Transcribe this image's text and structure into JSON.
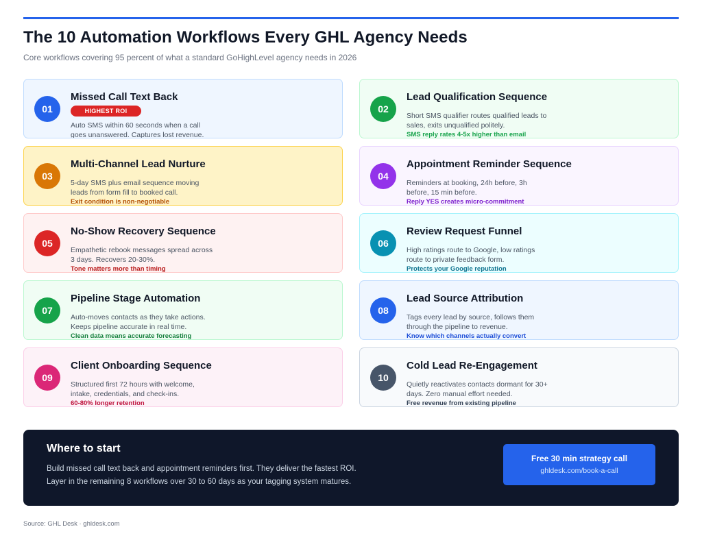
{
  "header": {
    "title": "The 10 Automation Workflows Every GHL Agency Needs",
    "subtitle": "Core workflows covering 95 percent of what a standard GoHighLevel agency needs in 2026"
  },
  "workflows": [
    {
      "number": "01",
      "title": "Missed Call Text Back",
      "badge": "HIGHEST ROI",
      "description": "Auto SMS within 60 seconds when a call goes unanswered. Captures lost revenue.",
      "note": ""
    },
    {
      "number": "02",
      "title": "Lead Qualification Sequence",
      "description": "Short SMS qualifier routes qualified leads to sales, exits unqualified politely.",
      "note": "SMS reply rates 4-5x higher than email"
    },
    {
      "number": "03",
      "title": "Multi-Channel Lead Nurture",
      "description": "5-day SMS plus email sequence moving leads from form fill to booked call.",
      "note": "Exit condition is non-negotiable"
    },
    {
      "number": "04",
      "title": "Appointment Reminder Sequence",
      "description": "Reminders at booking, 24h before, 3h before, 15 min before.",
      "note": "Reply YES creates micro-commitment"
    },
    {
      "number": "05",
      "title": "No-Show Recovery Sequence",
      "description": "Empathetic rebook messages spread across 3 days. Recovers 20-30%.",
      "note": "Tone matters more than timing"
    },
    {
      "number": "06",
      "title": "Review Request Funnel",
      "description": "High ratings route to Google, low ratings route to private feedback form.",
      "note": "Protects your Google reputation"
    },
    {
      "number": "07",
      "title": "Pipeline Stage Automation",
      "description": "Auto-moves contacts as they take actions. Keeps pipeline accurate in real time.",
      "note": "Clean data means accurate forecasting"
    },
    {
      "number": "08",
      "title": "Lead Source Attribution",
      "description": "Tags every lead by source, follows them through the pipeline to revenue.",
      "note": "Know which channels actually convert"
    },
    {
      "number": "09",
      "title": "Client Onboarding Sequence",
      "description": "Structured first 72 hours with welcome, intake, credentials, and check-ins.",
      "note": "60-80% longer retention"
    },
    {
      "number": "10",
      "title": "Cold Lead Re-Engagement",
      "description": "Quietly reactivates contacts dormant for 30+ days. Zero manual effort needed.",
      "note": "Free revenue from existing pipeline"
    }
  ],
  "colors": {
    "accent": "#2563eb",
    "cards": [
      {
        "bg": "#eff6ff",
        "border": "#bfdbfe",
        "circle": "#2563eb",
        "note": "#1d4ed8"
      },
      {
        "bg": "#f0fdf4",
        "border": "#bbf7d0",
        "circle": "#16a34a",
        "note": "#16a34a"
      },
      {
        "bg": "#fef3c7",
        "border": "#fcd34d",
        "circle": "#d97706",
        "note": "#b45309"
      },
      {
        "bg": "#faf5ff",
        "border": "#e9d5ff",
        "circle": "#9333ea",
        "note": "#7e22ce"
      },
      {
        "bg": "#fef2f2",
        "border": "#fecaca",
        "circle": "#dc2626",
        "note": "#b91c1c"
      },
      {
        "bg": "#ecfeff",
        "border": "#a5f3fc",
        "circle": "#0891b2",
        "note": "#0e7490"
      },
      {
        "bg": "#f0fdf4",
        "border": "#bbf7d0",
        "circle": "#16a34a",
        "note": "#15803d"
      },
      {
        "bg": "#eff6ff",
        "border": "#bfdbfe",
        "circle": "#2563eb",
        "note": "#1d4ed8"
      },
      {
        "bg": "#fdf2f8",
        "border": "#fbcfe8",
        "circle": "#db2777",
        "note": "#be123c"
      },
      {
        "bg": "#f8fafc",
        "border": "#cbd5e1",
        "circle": "#475569",
        "note": "#334155"
      }
    ]
  },
  "cta": {
    "heading": "Where to start",
    "text_line1": "Build missed call text back and appointment reminders first. They deliver the fastest ROI.",
    "text_line2": "Layer in the remaining 8 workflows over 30 to 60 days as your tagging system matures.",
    "button_label": "Free 30 min strategy call",
    "button_url_text": "ghldesk.com/book-a-call"
  },
  "footer": {
    "source": "Source: GHL Desk · ghldesk.com"
  }
}
